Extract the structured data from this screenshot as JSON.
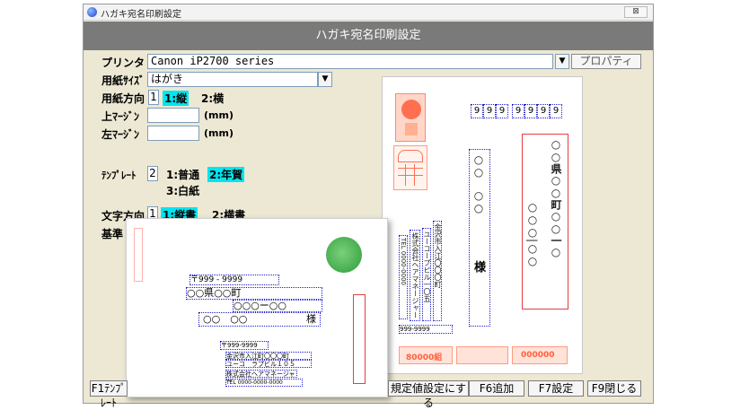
{
  "window": {
    "title": "ハガキ宛名印刷設定",
    "close_label": "⊠"
  },
  "header": {
    "title": "ハガキ宛名印刷設定"
  },
  "printer": {
    "label": "プリンタ",
    "value": "Canon iP2700 series",
    "properties_label": "プロパティ"
  },
  "paper_size": {
    "label": "用紙ｻｲｽﾞ",
    "value": "はがき"
  },
  "orientation": {
    "label": "用紙方向",
    "number": "1",
    "opt1": "1:縦",
    "opt2": "2:横"
  },
  "top_margin": {
    "label": "上ﾏｰｼﾞﾝ",
    "value": "",
    "unit": "(mm)"
  },
  "left_margin": {
    "label": "左ﾏｰｼﾞﾝ",
    "value": "",
    "unit": "(mm)"
  },
  "template": {
    "label": "ﾃﾝﾌﾟﾚｰﾄ",
    "number": "2",
    "opt1": "1:普通",
    "opt2": "2:年賀",
    "opt3": "3:白紙"
  },
  "text_direction": {
    "label": "文字方向",
    "number": "1",
    "opt1": "1:縦書",
    "opt2": "2:横書"
  },
  "base_label": "基準",
  "preview_main": {
    "postal": [
      "9",
      "9",
      "9",
      "9",
      "9",
      "9",
      "9"
    ],
    "pref": "○○県○○町○○一○",
    "recipient_circles": "○○\n○○",
    "honorific": "様",
    "sender_address": "金沢市入江〇〇〇町",
    "sender_building": "ユーコープビル一〇五",
    "company": "株式会社ヘアマネージャー",
    "tel": "TEL 0000-0000",
    "sender_postal": "999-9999",
    "stamp_left": "80000組",
    "stamp_right": "000000"
  },
  "preview_overlay": {
    "postal": "〒999 - 9999",
    "pref": "○○県○○町",
    "addr2": "○○○ー○○",
    "recipient": "○○　○○",
    "honorific": "様",
    "sender_postal": "〒999-9999",
    "sender_address": "金沢市入江町〇〇〇町",
    "sender_building": "ユーコ　ラプビル１０５",
    "company": "株式会社ヘアマネージャー",
    "tel": "TEL 0000-0000-0000"
  },
  "footer": {
    "f1": "F1ﾃﾝﾌﾟﾚｰﾄ",
    "f5": "規定値設定にする",
    "f6": "F6追加",
    "f7": "F7設定",
    "f9": "F9閉じる"
  },
  "colors": {
    "accent": "#00e5f0",
    "header": "#7a7a7a",
    "body": "#ece8d4",
    "frame": "#1b1bd0",
    "stamp": "#ff6040"
  }
}
